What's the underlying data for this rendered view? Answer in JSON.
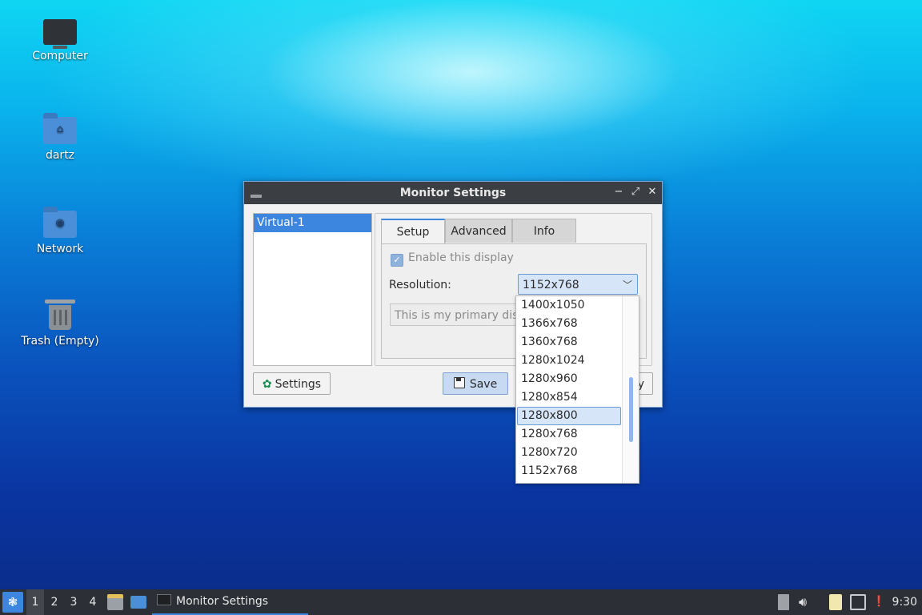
{
  "desktop": {
    "icons": [
      {
        "label": "Computer",
        "icon": "computer-icon"
      },
      {
        "label": "dartz",
        "icon": "home-folder-icon"
      },
      {
        "label": "Network",
        "icon": "network-folder-icon"
      },
      {
        "label": "Trash (Empty)",
        "icon": "trash-icon"
      }
    ]
  },
  "window": {
    "title": "Monitor Settings",
    "controls": {
      "minimize": "−",
      "restore": "⤢",
      "close": "✕"
    },
    "monitors": [
      "Virtual-1"
    ],
    "tabs": [
      "Setup",
      "Advanced",
      "Info"
    ],
    "active_tab": "Setup",
    "setup": {
      "enable_label": "Enable this display",
      "enable_checked": true,
      "resolution_label": "Resolution:",
      "resolution_value": "1152x768",
      "primary_text": "This is my primary display"
    },
    "buttons": {
      "settings": "Settings",
      "save": "Save",
      "apply_partial": "y"
    }
  },
  "resolution_dropdown": {
    "options": [
      "1400x1050",
      "1366x768",
      "1360x768",
      "1280x1024",
      "1280x960",
      "1280x854",
      "1280x800",
      "1280x768",
      "1280x720",
      "1152x768"
    ],
    "highlighted": "1280x800"
  },
  "taskbar": {
    "workspaces": [
      "1",
      "2",
      "3",
      "4"
    ],
    "active_workspace": "1",
    "task_title": "Monitor Settings",
    "clock": "9:30"
  },
  "colors": {
    "accent": "#3d86e0",
    "titlebar": "#3b3f44",
    "taskbar": "#2c3036"
  }
}
